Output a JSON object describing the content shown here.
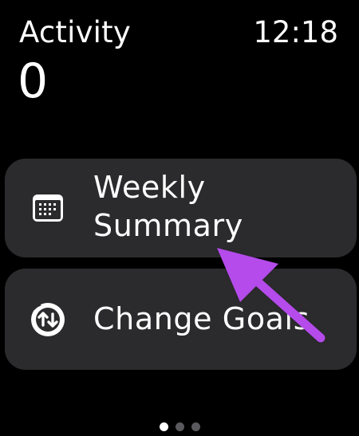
{
  "header": {
    "title": "Activity",
    "time": "12:18"
  },
  "partial_value": "0",
  "menu": {
    "items": [
      {
        "label": "Weekly Summary",
        "icon": "calendar-icon"
      },
      {
        "label": "Change Goals",
        "icon": "change-goals-icon"
      }
    ]
  },
  "pagination": {
    "total": 3,
    "current": 1
  },
  "annotation": {
    "color": "#b44bea",
    "icon": "arrow-pointer"
  },
  "colors": {
    "background": "#000000",
    "card": "#2b2b2d",
    "text": "#ffffff",
    "dot_inactive": "#5a5a5e"
  }
}
